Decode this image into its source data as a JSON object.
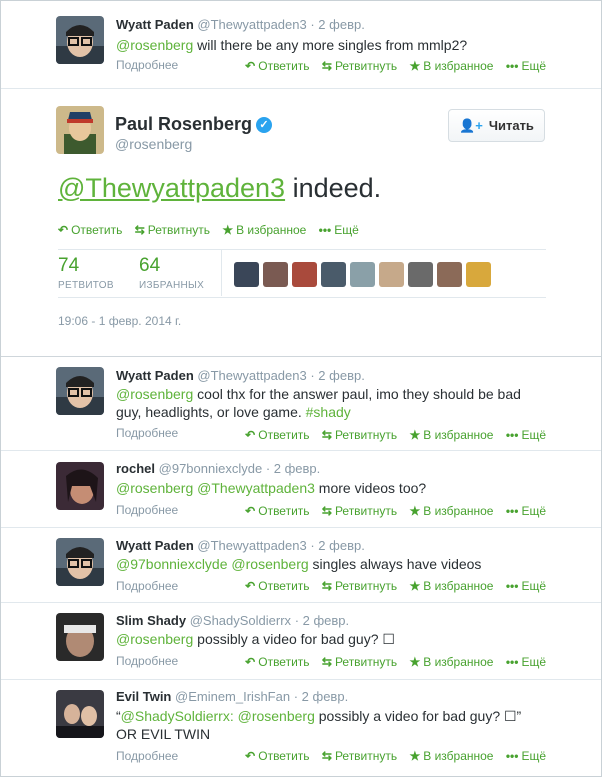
{
  "actions": {
    "reply": "Ответить",
    "retweet": "Ретвитнуть",
    "favorite": "В избранное",
    "more": "Ещё"
  },
  "details_label": "Подробнее",
  "top_tweet": {
    "name": "Wyatt Paden",
    "handle": "@Thewyattpaden3",
    "time": "· 2 февр.",
    "mention": "@rosenberg",
    "text": " will there be any more singles from mmlp2?"
  },
  "main_tweet": {
    "name": "Paul Rosenberg",
    "handle": "@rosenberg",
    "follow_label": "Читать",
    "mention": "@Thewyattpaden3",
    "text": " indeed.",
    "retweets": {
      "count": "74",
      "label": "РЕТВИТОВ"
    },
    "favorites": {
      "count": "64",
      "label": "ИЗБРАННЫХ"
    },
    "timestamp": "19:06 - 1 февр. 2014 г."
  },
  "replies": [
    {
      "name": "Wyatt Paden",
      "handle": "@Thewyattpaden3",
      "time": "· 2 февр.",
      "parts": [
        {
          "t": "@rosenberg",
          "g": true
        },
        {
          "t": " cool thx for the answer paul, imo they should be bad guy, headlights, or love game. ",
          "g": false
        },
        {
          "t": "#shady",
          "g": true
        }
      ]
    },
    {
      "name": "rochel",
      "handle": "@97bonniexclyde",
      "time": "· 2 февр.",
      "parts": [
        {
          "t": "@rosenberg",
          "g": true
        },
        {
          "t": " ",
          "g": false
        },
        {
          "t": "@Thewyattpaden3",
          "g": true
        },
        {
          "t": " more videos too?",
          "g": false
        }
      ]
    },
    {
      "name": "Wyatt Paden",
      "handle": "@Thewyattpaden3",
      "time": "· 2 февр.",
      "parts": [
        {
          "t": "@97bonniexclyde",
          "g": true
        },
        {
          "t": " ",
          "g": false
        },
        {
          "t": "@rosenberg",
          "g": true
        },
        {
          "t": " singles always have videos",
          "g": false
        }
      ]
    },
    {
      "name": "Slim Shady",
      "handle": "@ShadySoldierrx",
      "time": "· 2 февр.",
      "parts": [
        {
          "t": "@rosenberg",
          "g": true
        },
        {
          "t": " possibly a video for bad guy? ☐",
          "g": false
        }
      ]
    },
    {
      "name": "Evil Twin",
      "handle": "@Eminem_IrishFan",
      "time": "· 2 февр.",
      "parts": [
        {
          "t": "“",
          "g": false
        },
        {
          "t": "@ShadySoldierrx",
          "g": true
        },
        {
          "t": ": ",
          "g": false
        },
        {
          "t": "@rosenberg",
          "g": true
        },
        {
          "t": " possibly a video for bad guy? ☐” OR EVIL TWIN",
          "g": false
        }
      ]
    }
  ],
  "colors": {
    "accent_green": "#48a22f",
    "link_green": "#5fb33b",
    "verified_blue": "#2aa3ef",
    "muted": "#8899a6"
  },
  "icons": [
    "reply-icon",
    "retweet-icon",
    "star-icon",
    "more-dots-icon",
    "verified-icon",
    "follow-person-icon"
  ]
}
